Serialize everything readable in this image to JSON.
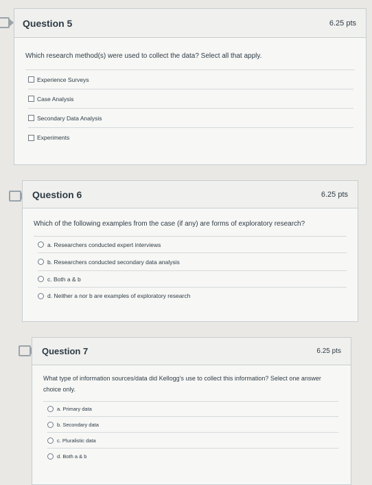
{
  "questions": [
    {
      "title": "Question 5",
      "points": "6.25 pts",
      "text": "Which research method(s) were used to collect the data? Select all that apply.",
      "options": [
        "Experience Surveys",
        "Case Analysis",
        "Secondary Data Analysis",
        "Experiments"
      ]
    },
    {
      "title": "Question 6",
      "points": "6.25 pts",
      "text": "Which of the following examples from the case (if any) are forms of exploratory research?",
      "options": [
        "a. Researchers conducted expert interviews",
        "b. Researchers conducted secondary data analysis",
        "c. Both a & b",
        "d. Neither a nor b are examples of exploratory research"
      ]
    },
    {
      "title": "Question 7",
      "points": "6.25 pts",
      "text": "What type of information sources/data did Kellogg's use to collect this information? Select one answer choice only.",
      "options": [
        "a. Primary data",
        "b. Secondary data",
        "c. Pluralistic data",
        "d. Both a & b"
      ]
    }
  ]
}
